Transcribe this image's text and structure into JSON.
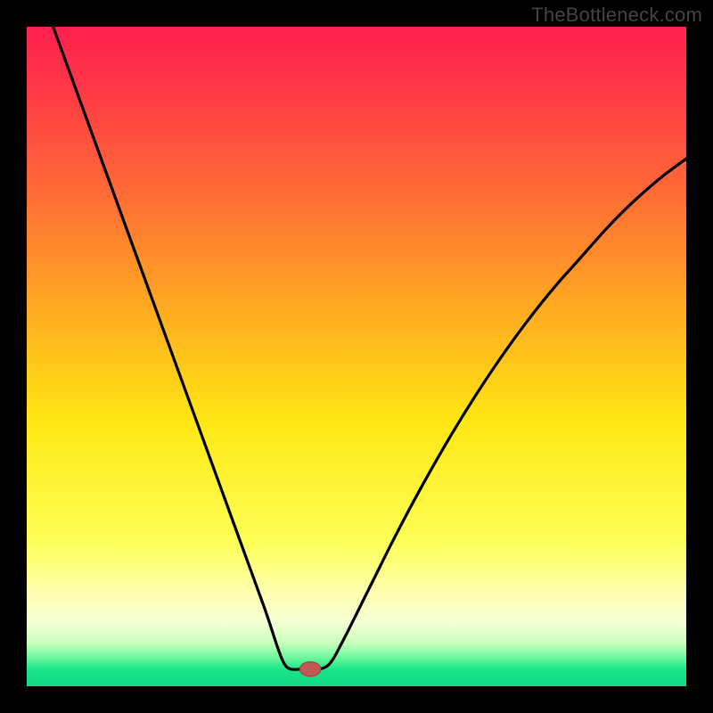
{
  "watermark": "TheBottleneck.com",
  "colors": {
    "frame": "#000000",
    "curve": "#000000",
    "dot_fill": "#c05a54",
    "dot_stroke": "#a03a34",
    "gradient_stops": [
      {
        "offset": 0.0,
        "color": "#ff1f4f"
      },
      {
        "offset": 0.1,
        "color": "#ff3a46"
      },
      {
        "offset": 0.25,
        "color": "#ff6a36"
      },
      {
        "offset": 0.45,
        "color": "#ffb21e"
      },
      {
        "offset": 0.6,
        "color": "#ffe713"
      },
      {
        "offset": 0.78,
        "color": "#fdff55"
      },
      {
        "offset": 0.86,
        "color": "#feffb0"
      },
      {
        "offset": 0.905,
        "color": "#f3ffd6"
      },
      {
        "offset": 0.935,
        "color": "#c6ffba"
      },
      {
        "offset": 0.955,
        "color": "#73f99e"
      },
      {
        "offset": 0.975,
        "color": "#18e58a"
      },
      {
        "offset": 1.0,
        "color": "#12d985"
      }
    ]
  },
  "chart_data": {
    "type": "line",
    "title": "",
    "xlabel": "",
    "ylabel": "",
    "xlim": [
      0,
      100
    ],
    "ylim": [
      0,
      100
    ],
    "grid": false,
    "legend": false,
    "note": "Values are approximate, read from the rendered curve. x is percent across the inner plot (0=left, 100=right); y is percent up from the bottom of the inner plot (0=bottom, 100=top).",
    "series": [
      {
        "name": "left-branch",
        "x": [
          4,
          8,
          12,
          16,
          20,
          24,
          28,
          32,
          36,
          38,
          39,
          40,
          41.5
        ],
        "y": [
          100,
          89,
          78,
          67,
          56,
          45,
          34,
          23,
          12,
          6,
          3.5,
          2.6,
          2.6
        ]
      },
      {
        "name": "right-branch",
        "x": [
          44.5,
          46,
          48,
          52,
          56,
          60,
          64,
          68,
          72,
          76,
          80,
          84,
          88,
          92,
          96,
          100
        ],
        "y": [
          2.6,
          3.5,
          7,
          15,
          23,
          30.5,
          37.5,
          44,
          50,
          55.5,
          60.5,
          65,
          69.5,
          73.5,
          77,
          80
        ]
      }
    ],
    "flat_segment": {
      "x": [
        41.5,
        44.5
      ],
      "y": 2.6
    },
    "marker": {
      "x": 43,
      "y": 2.6,
      "rx": 1.6,
      "ry": 1.1
    }
  }
}
